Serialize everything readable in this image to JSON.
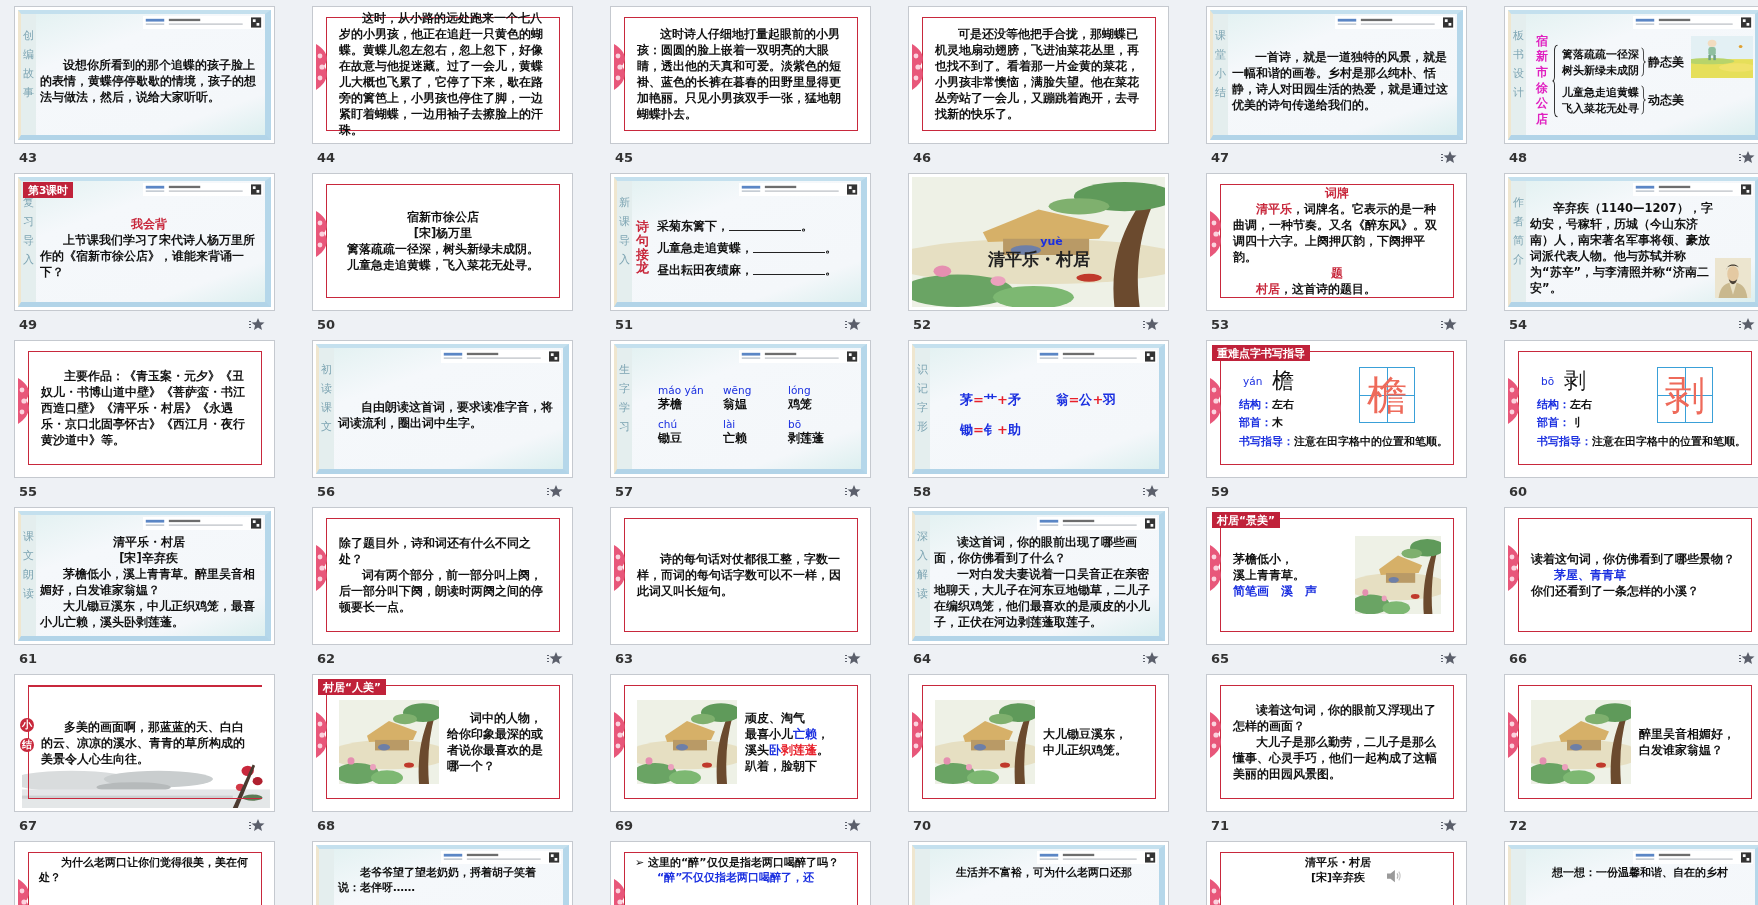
{
  "slides": [
    {
      "number": "43",
      "kind": "template",
      "animated": false,
      "side_label": "创编故事",
      "blocks": [
        {
          "kind": "para",
          "text": "设想你所看到的那个追蝶的孩子脸上的表情，黄蝶停停歇歇的情境，孩子的想法与做法，然后，说给大家听听。"
        }
      ]
    },
    {
      "number": "44",
      "kind": "framed",
      "animated": false,
      "blocks": [
        {
          "kind": "para",
          "text": "这时，从小路的远处跑来一个七八岁的小男孩，他正在追赶一只黄色的蝴蝶。黄蝶儿忽左忽右，忽上忽下，好像在故意与他捉迷藏。过了一会儿，黄蝶儿大概也飞累了，它停了下来，歇在路旁的篱笆上，小男孩也停住了脚，一边紧盯着蝴蝶，一边用袖子去擦脸上的汗珠。"
        }
      ]
    },
    {
      "number": "45",
      "kind": "framed",
      "animated": false,
      "blocks": [
        {
          "kind": "para",
          "text": "这时诗人仔细地打量起眼前的小男孩：圆圆的脸上嵌着一双明亮的大眼睛，透出他的天真和可爱。淡紫色的短褂、蓝色的长裤在暮春的田野里显得更加艳丽。只见小男孩双手一张，猛地朝蝴蝶扑去。"
        }
      ]
    },
    {
      "number": "46",
      "kind": "framed",
      "animated": false,
      "blocks": [
        {
          "kind": "para",
          "text": "可是还没等他把手合拢，那蝴蝶已机灵地扇动翅膀，飞进油菜花丛里，再也找不到了。看着那一片金黄的菜花，小男孩非常懊恼，满脸失望。他在菜花丛旁站了一会儿，又蹦跳着跑开，去寻找新的快乐了。"
        }
      ]
    },
    {
      "number": "47",
      "kind": "template",
      "animated": true,
      "side_label": "课堂小结",
      "blocks": [
        {
          "kind": "para",
          "text": "一首诗，就是一道独特的风景，就是一幅和谐的画卷。乡村是那么纯朴、恬静，诗人对田园生活的热爱，就是通过这优美的诗句传递给我们的。"
        }
      ]
    },
    {
      "number": "48",
      "kind": "template",
      "animated": true,
      "side_label": "板书设计",
      "picture": {
        "kind": "field"
      },
      "blocks": [
        {
          "kind": "board",
          "title": "宿新市徐公店",
          "groups": [
            {
              "lines": [
                "篱落疏疏一径深",
                "树头新绿未成阴"
              ],
              "label": "静态美"
            },
            {
              "lines": [
                "儿童急走追黄蝶",
                "飞入菜花无处寻"
              ],
              "label": "动态美"
            }
          ]
        }
      ]
    },
    {
      "number": "49",
      "kind": "template",
      "animated": true,
      "side_label": "复习导入",
      "tag": "第3课时",
      "blocks": [
        {
          "kind": "heading",
          "color": "#c8283c",
          "text": "我会背"
        },
        {
          "kind": "para",
          "text": "上节课我们学习了宋代诗人杨万里所作的《宿新市徐公店》，谁能来背诵一下？"
        }
      ]
    },
    {
      "number": "50",
      "kind": "framed",
      "animated": false,
      "blocks": [
        {
          "kind": "center",
          "text": "宿新市徐公店"
        },
        {
          "kind": "center",
          "text": "[宋]杨万里"
        },
        {
          "kind": "center",
          "text": "篱落疏疏一径深，树头新绿未成阴。"
        },
        {
          "kind": "center",
          "text": "儿童急走追黄蝶，飞入菜花无处寻。"
        }
      ]
    },
    {
      "number": "51",
      "kind": "template",
      "animated": true,
      "side_label": "新课导入",
      "vertical_title": "诗句接龙",
      "blocks": [
        {
          "kind": "blank",
          "text": "采菊东篱下，",
          "end": "。"
        },
        {
          "kind": "blank",
          "text": "儿童急走追黄蝶，",
          "end": "。"
        },
        {
          "kind": "blank",
          "text": "昼出耘田夜绩麻，",
          "end": "。"
        }
      ]
    },
    {
      "number": "52",
      "kind": "scene",
      "animated": true,
      "blocks": [
        {
          "kind": "title",
          "pinyin": "yuè",
          "text": "清平乐・村居"
        }
      ]
    },
    {
      "number": "53",
      "kind": "framed",
      "animated": true,
      "blocks": [
        {
          "kind": "heading",
          "color": "#c8283c",
          "text": "词牌"
        },
        {
          "kind": "para",
          "runs": [
            {
              "text": "清平乐",
              "color": "#c8283c"
            },
            {
              "text": "，词牌名。它表示的是一种曲调，一种节奏。又名《醉东风》。双调四十六字。上阕押仄韵，下阕押平韵。"
            }
          ]
        },
        {
          "kind": "heading",
          "color": "#c8283c",
          "text": "题"
        },
        {
          "kind": "para",
          "runs": [
            {
              "text": "村居",
              "color": "#c8283c"
            },
            {
              "text": "，这首诗的题目。"
            }
          ]
        }
      ]
    },
    {
      "number": "54",
      "kind": "template",
      "animated": true,
      "side_label": "作者简介",
      "picture": {
        "kind": "portrait"
      },
      "blocks": [
        {
          "kind": "para",
          "text": "辛弃疾（1140—1207），字幼安，号稼轩，历城（今山东济南）人，南宋著名军事将领、豪放词派代表人物。他与苏轼并称为“苏辛”，与李清照并称“济南二安”。"
        }
      ]
    },
    {
      "number": "55",
      "kind": "framed",
      "animated": false,
      "blocks": [
        {
          "kind": "para",
          "text": "主要作品：《青玉案・元夕》《丑奴儿・书博山道中壁》《菩萨蛮・书江西造口壁》《清平乐・村居》《永遇乐・京口北固亭怀古》《西江月・夜行黄沙道中》等。"
        }
      ]
    },
    {
      "number": "56",
      "kind": "template",
      "animated": true,
      "side_label": "初读课文",
      "blocks": [
        {
          "kind": "para",
          "text": "自由朗读这首词，要求读准字音，将词读流利，圈出词中生字。"
        }
      ]
    },
    {
      "number": "57",
      "kind": "template",
      "animated": true,
      "side_label": "生字学习",
      "blocks": [
        {
          "kind": "pinyin_grid",
          "items": [
            {
              "pinyin": "máo yán",
              "word": "茅檐"
            },
            {
              "pinyin": "wēng",
              "word": "翁媪"
            },
            {
              "pinyin": "lóng",
              "word": "鸡笼"
            },
            {
              "pinyin": "chú",
              "word": "锄豆"
            },
            {
              "pinyin": "lài",
              "word": "亡赖"
            },
            {
              "pinyin": "bō",
              "word": "剥莲蓬"
            }
          ]
        }
      ]
    },
    {
      "number": "58",
      "kind": "template",
      "animated": true,
      "side_label": "识记字形",
      "blocks": [
        {
          "kind": "formulas",
          "items": [
            {
              "runs": [
                {
                  "text": "茅",
                  "color": "#1a2fe0"
                },
                {
                  "text": "=",
                  "color": "#e8202a"
                },
                {
                  "text": "艹",
                  "color": "#1a2fe0"
                },
                {
                  "text": "+",
                  "color": "#e8202a"
                },
                {
                  "text": "矛",
                  "color": "#1a2fe0"
                }
              ]
            },
            {
              "runs": [
                {
                  "text": "翁",
                  "color": "#1a2fe0"
                },
                {
                  "text": "=",
                  "color": "#e8202a"
                },
                {
                  "text": "公",
                  "color": "#1a2fe0"
                },
                {
                  "text": "+",
                  "color": "#e8202a"
                },
                {
                  "text": "羽",
                  "color": "#1a2fe0"
                }
              ]
            },
            {
              "runs": [
                {
                  "text": "锄",
                  "color": "#1a2fe0"
                },
                {
                  "text": "=",
                  "color": "#e8202a"
                },
                {
                  "text": "钅",
                  "color": "#1a2fe0"
                },
                {
                  "text": "+",
                  "color": "#e8202a"
                },
                {
                  "text": "助",
                  "color": "#1a2fe0"
                }
              ]
            }
          ]
        }
      ]
    },
    {
      "number": "59",
      "kind": "framed",
      "animated": false,
      "tag": "重难点字书写指导",
      "blocks": [
        {
          "kind": "char_card",
          "pinyin": "yán",
          "char": "檐",
          "grid_char": "檐",
          "rows": [
            [
              {
                "text": "结构：",
                "color": "#1a2fe0"
              },
              {
                "text": "左右"
              }
            ],
            [
              {
                "text": "部首：",
                "color": "#1a2fe0"
              },
              {
                "text": "木"
              }
            ]
          ],
          "guide": [
            {
              "text": "书写指导：",
              "color": "#1a2fe0"
            },
            {
              "text": "注意在田字格中的位置和笔顺。"
            }
          ]
        }
      ]
    },
    {
      "number": "60",
      "kind": "framed",
      "animated": false,
      "blocks": [
        {
          "kind": "char_card",
          "pinyin": "bō",
          "char": "剥",
          "grid_char": "剥",
          "rows": [
            [
              {
                "text": "结构：",
                "color": "#1a2fe0"
              },
              {
                "text": "左右"
              }
            ],
            [
              {
                "text": "部首：",
                "color": "#1a2fe0"
              },
              {
                "text": "刂"
              }
            ]
          ],
          "guide": [
            {
              "text": "书写指导：",
              "color": "#1a2fe0"
            },
            {
              "text": "注意在田字格中的位置和笔顺。"
            }
          ]
        }
      ]
    },
    {
      "number": "61",
      "kind": "template",
      "animated": false,
      "side_label": "课文朗读",
      "blocks": [
        {
          "kind": "center",
          "text": "清平乐・村居"
        },
        {
          "kind": "center",
          "text": "[宋]辛弃疾"
        },
        {
          "kind": "para",
          "text": "茅檐低小，溪上青青草。醉里吴音相媚好，白发谁家翁媪？"
        },
        {
          "kind": "para",
          "text": "大儿锄豆溪东，中儿正织鸡笼，最喜小儿亡赖，溪头卧剥莲蓬。"
        }
      ]
    },
    {
      "number": "62",
      "kind": "framed",
      "animated": true,
      "blocks": [
        {
          "kind": "line",
          "text": "除了题目外，诗和词还有什么不同之处？"
        },
        {
          "kind": "para",
          "text": "词有两个部分，前一部分叫上阕，后一部分叫下阕，朗读时两阕之间的停顿要长一点。"
        }
      ]
    },
    {
      "number": "63",
      "kind": "framed",
      "animated": true,
      "blocks": [
        {
          "kind": "para",
          "text": "诗的每句话对仗都很工整，字数一样，而词的每句话字数可以不一样，因此词又叫长短句。"
        }
      ]
    },
    {
      "number": "64",
      "kind": "template",
      "animated": true,
      "side_label": "深入解读",
      "blocks": [
        {
          "kind": "para",
          "text": "读这首词，你的眼前出现了哪些画面，你仿佛看到了什么？"
        },
        {
          "kind": "para",
          "text": "一对白发夫妻说着一口吴音正在亲密地聊天，大儿子在河东豆地锄草，二儿子在编织鸡笼，他们最喜欢的是顽皮的小儿子，正伏在河边剥莲蓬取莲子。"
        }
      ]
    },
    {
      "number": "65",
      "kind": "framed",
      "animated": true,
      "tag": "村居“景美”",
      "picture": {
        "kind": "right"
      },
      "blocks": [
        {
          "kind": "line",
          "text": "茅檐低小，"
        },
        {
          "kind": "line",
          "text": "溪上青青草。"
        },
        {
          "kind": "line",
          "color": "#1a2fe0",
          "text": "简笔画　溪　声"
        }
      ]
    },
    {
      "number": "66",
      "kind": "framed",
      "animated": true,
      "blocks": [
        {
          "kind": "line",
          "text": "读着这句词，你仿佛看到了哪些景物？"
        },
        {
          "kind": "para",
          "color": "#1a2fe0",
          "text": "茅屋、青青草"
        },
        {
          "kind": "line",
          "text": "你们还看到了一条怎样的小溪？"
        }
      ]
    },
    {
      "number": "67",
      "kind": "summary",
      "animated": true,
      "badges": [
        "小",
        "结"
      ],
      "picture": {
        "kind": "landscape"
      },
      "blocks": [
        {
          "kind": "para",
          "text": "多美的画面啊，那蓝蓝的天、白白的云、凉凉的溪水、青青的草所构成的美景令人心生向往。"
        }
      ]
    },
    {
      "number": "68",
      "kind": "framed",
      "animated": false,
      "tag": "村居“人美”",
      "picture": {
        "kind": "left"
      },
      "blocks": [
        {
          "kind": "para",
          "text": "词中的人物，给你印象最深的或者说你最喜欢的是哪一个？"
        }
      ]
    },
    {
      "number": "69",
      "kind": "framed",
      "animated": true,
      "picture": {
        "kind": "left"
      },
      "blocks": [
        {
          "kind": "line",
          "text": "顽皮、淘气"
        },
        {
          "kind": "line",
          "runs": [
            {
              "text": "最喜小儿"
            },
            {
              "text": "亡赖",
              "color": "#1a2fe0"
            },
            {
              "text": "，"
            }
          ]
        },
        {
          "kind": "line",
          "runs": [
            {
              "text": "溪头"
            },
            {
              "text": "卧",
              "color": "#1a2fe0"
            },
            {
              "text": "剥莲蓬",
              "color": "#e8202a"
            },
            {
              "text": "。"
            }
          ]
        },
        {
          "kind": "line",
          "text": "趴着，脸朝下"
        }
      ]
    },
    {
      "number": "70",
      "kind": "framed",
      "animated": false,
      "picture": {
        "kind": "left"
      },
      "blocks": [
        {
          "kind": "line",
          "text": "大儿锄豆溪东，"
        },
        {
          "kind": "line",
          "text": "中儿正织鸡笼。"
        }
      ]
    },
    {
      "number": "71",
      "kind": "framed",
      "animated": true,
      "blocks": [
        {
          "kind": "para",
          "text": "读着这句词，你的眼前又浮现出了怎样的画面？"
        },
        {
          "kind": "para",
          "text": "大儿子是那么勤劳，二儿子是那么懂事、心灵手巧，他们一起构成了这幅美丽的田园风景图。"
        }
      ]
    },
    {
      "number": "72",
      "kind": "framed",
      "animated": false,
      "picture": {
        "kind": "left"
      },
      "blocks": [
        {
          "kind": "line",
          "text": "醉里吴音相媚好，"
        },
        {
          "kind": "line",
          "text": "白发谁家翁媪？"
        }
      ]
    },
    {
      "kind": "framed",
      "blocks": [
        {
          "kind": "para",
          "text": "为什么老两口让你们觉得很美，美在何处？"
        }
      ]
    },
    {
      "kind": "template",
      "blocks": [
        {
          "kind": "para",
          "text": "老爷爷望了望老奶奶，捋着胡子笑着说：老伴呀……"
        }
      ]
    },
    {
      "kind": "framed",
      "blocks": [
        {
          "kind": "line",
          "text": "➢ 这里的“醉”仅仅是指老两口喝醉了吗？"
        },
        {
          "kind": "para",
          "color": "#1a2fe0",
          "text": "“醉”不仅仅指老两口喝醉了，还"
        }
      ]
    },
    {
      "kind": "template",
      "blocks": [
        {
          "kind": "para",
          "text": "生活并不富裕，可为什么老两口还那"
        }
      ]
    },
    {
      "kind": "framed",
      "audio": true,
      "blocks": [
        {
          "kind": "center",
          "text": "清平乐・村居"
        },
        {
          "kind": "center",
          "text": "[宋]辛弃疾"
        }
      ]
    },
    {
      "kind": "template",
      "blocks": [
        {
          "kind": "para",
          "text": "想一想：一份温馨和谐、自在的乡村"
        }
      ]
    }
  ]
}
